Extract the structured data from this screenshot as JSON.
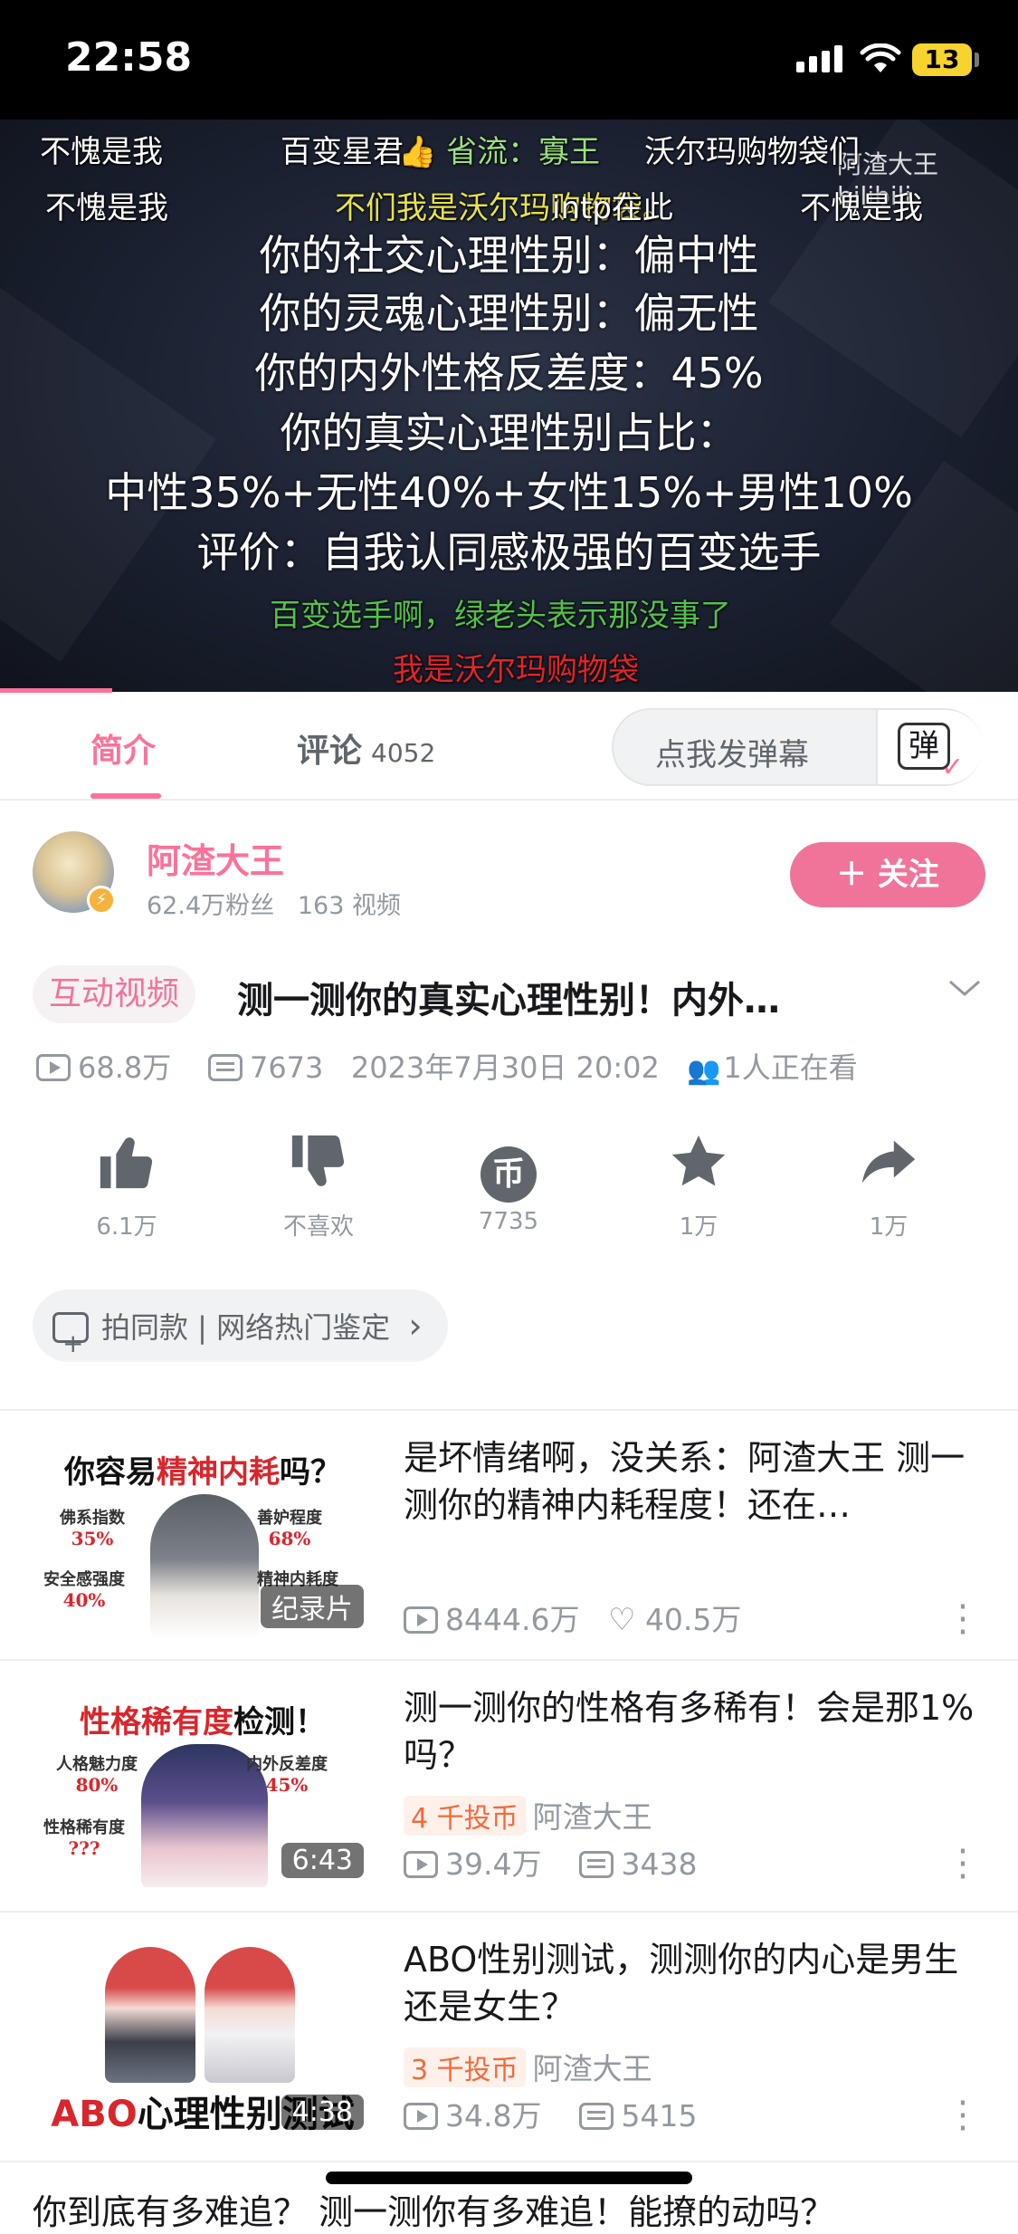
{
  "status_bar": {
    "time": "22:58",
    "battery": "13"
  },
  "video": {
    "watermark": "阿渣大王 bilibili",
    "danmaku": [
      {
        "text": "不愧是我",
        "color": "#ffffff"
      },
      {
        "text": "百变星君",
        "color": "#ffffff"
      },
      {
        "text": "👍 省流：寡王",
        "color": "#9be07f"
      },
      {
        "text": "沃尔玛购物袋们",
        "color": "#ffffff"
      },
      {
        "text": "不愧是我",
        "color": "#ffffff"
      },
      {
        "text": "不们我是沃尔玛购物袋。",
        "color": "#e8e24a"
      },
      {
        "text": "intp在此",
        "color": "#ffffff"
      },
      {
        "text": "不愧是我",
        "color": "#ffffff"
      },
      {
        "text": "百变选手啊，绿老头表示那没事了",
        "color": "#53c14a"
      },
      {
        "text": "我是沃尔玛购物袋",
        "color": "#e4232a"
      }
    ],
    "subtitles": [
      "你的社交心理性别：偏中性",
      "你的灵魂心理性别：偏无性",
      "你的内外性格反差度：45%",
      "你的真实心理性别占比：",
      "中性35%+无性40%+女性15%+男性10%",
      "评价：自我认同感极强的百变选手"
    ],
    "progress": 0.11
  },
  "tabs": {
    "intro": "简介",
    "comments": "评论",
    "comments_count": "4052",
    "danmaku_placeholder": "点我发弹幕",
    "danmaku_icon": "弹"
  },
  "uploader": {
    "name": "阿渣大王",
    "fans": "62.4万粉丝",
    "videos": "163 视频",
    "follow": "＋ 关注"
  },
  "video_info": {
    "tag": "互动视频",
    "title": "测一测你的真实心理性别！内外…",
    "views": "68.8万",
    "danmaku_count": "7673",
    "date": "2023年7月30日 20:02",
    "watching": "1人正在看"
  },
  "actions": [
    {
      "icon": "thumbs-up-icon",
      "label": "6.1万"
    },
    {
      "icon": "thumbs-down-icon",
      "label": "不喜欢"
    },
    {
      "icon": "coin-icon",
      "label": "7735"
    },
    {
      "icon": "star-icon",
      "label": "1万"
    },
    {
      "icon": "share-icon",
      "label": "1万"
    }
  ],
  "same_style": {
    "text": "拍同款 | 网络热门鉴定",
    "chevron": "›"
  },
  "recommendations": [
    {
      "thumb_head_pre": "你容易",
      "thumb_head_red": "精神内耗",
      "thumb_head_post": "吗？",
      "thumb_labels": [
        [
          "佛系指数",
          "35%"
        ],
        [
          "善妒程度",
          "68%"
        ],
        [
          "安全感强度",
          "40%"
        ],
        [
          "精神内耗度",
          ""
        ]
      ],
      "badge": "纪录片",
      "title": "是坏情绪啊，没关系：阿渣大王 测一测你的精神内耗程度！还在…",
      "views": "8444.6万",
      "likes": "40.5万"
    },
    {
      "thumb_head_pre": "",
      "thumb_head_red": "性格稀有度",
      "thumb_head_post": "检测！",
      "thumb_labels": [
        [
          "人格魅力度",
          "80%"
        ],
        [
          "内外反差度",
          "45%"
        ],
        [
          "性格稀有度",
          "???"
        ]
      ],
      "badge": "6:43",
      "title": "测一测你的性格有多稀有！会是那1%吗？",
      "coin_tag": "4 千投币",
      "author": "阿渣大王",
      "views": "39.4万",
      "danmaku": "3438"
    },
    {
      "thumb_head_pre": "ABO",
      "thumb_head_red": "",
      "thumb_head_post": "心理性别测试",
      "badge": "4:38",
      "title": "ABO性别测试，测测你的内心是男生还是女生？",
      "coin_tag": "3 千投币",
      "author": "阿渣大王",
      "views": "34.8万",
      "danmaku": "5415"
    }
  ],
  "next_peek": "你到底有多难追？  测一测你有多难追！能撩的动吗？",
  "colors": {
    "accent": "#fb7299",
    "follow": "#f0749a",
    "muted": "#9499a0"
  }
}
